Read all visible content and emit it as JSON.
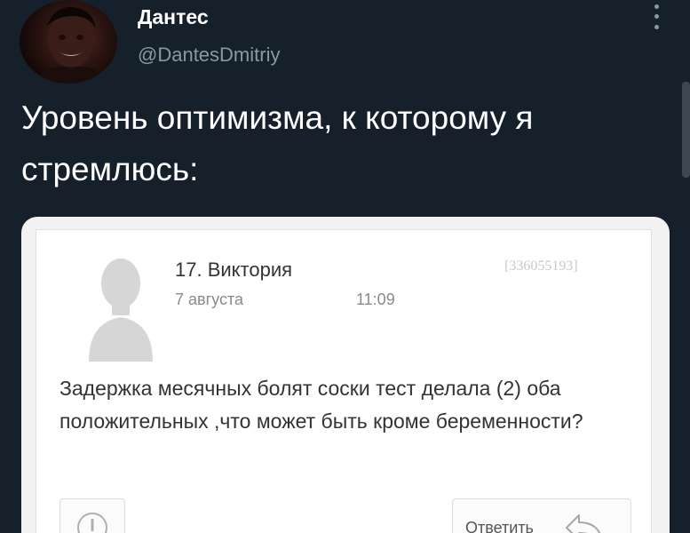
{
  "tweet": {
    "author": {
      "display_name": "Дантес",
      "handle": "@DantesDmitriy"
    },
    "text": "Уровень оптимизма, к которому я стремлюсь:",
    "more_icon": "more-vertical-icon"
  },
  "screenshot_card": {
    "poster": "17. Виктория",
    "post_id": "[336055193]",
    "date": "7 августа",
    "time": "11:09",
    "question": "Задержка месячных болят соски тест делала (2) оба положительных ,что может быть кроме беременности?",
    "report_icon": "exclamation-icon",
    "reply_label": "Ответить",
    "reply_icon": "reply-arrow-icon"
  },
  "colors": {
    "background": "#15202b",
    "handle": "#8899a6",
    "card": "#ffffff"
  }
}
